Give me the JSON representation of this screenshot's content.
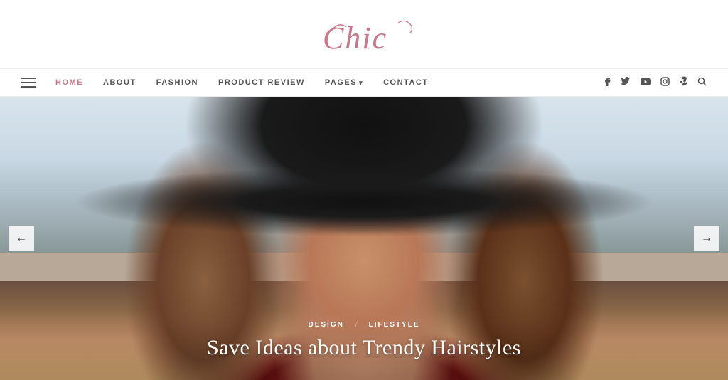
{
  "header": {
    "logo": "Chic",
    "logo_subtitle": "✦"
  },
  "nav": {
    "hamburger_label": "menu",
    "links": [
      {
        "label": "HOME",
        "active": true,
        "id": "home"
      },
      {
        "label": "ABOUT",
        "active": false,
        "id": "about"
      },
      {
        "label": "FASHION",
        "active": false,
        "id": "fashion"
      },
      {
        "label": "PRODUCT REVIEW",
        "active": false,
        "id": "product-review"
      },
      {
        "label": "PAGES",
        "active": false,
        "id": "pages",
        "has_dropdown": true
      },
      {
        "label": "CONTACT",
        "active": false,
        "id": "contact"
      }
    ]
  },
  "social": {
    "icons": [
      {
        "name": "facebook",
        "symbol": "f"
      },
      {
        "name": "twitter",
        "symbol": "t"
      },
      {
        "name": "youtube",
        "symbol": "▶"
      },
      {
        "name": "instagram",
        "symbol": "◻"
      },
      {
        "name": "pinterest",
        "symbol": "p"
      },
      {
        "name": "search",
        "symbol": "🔍"
      }
    ]
  },
  "hero": {
    "prev_label": "←",
    "next_label": "→",
    "tags": [
      "DESIGN",
      "LIFESTYLE"
    ],
    "tag_separator": "/",
    "title": "Save Ideas about Trendy Hairstyles"
  }
}
